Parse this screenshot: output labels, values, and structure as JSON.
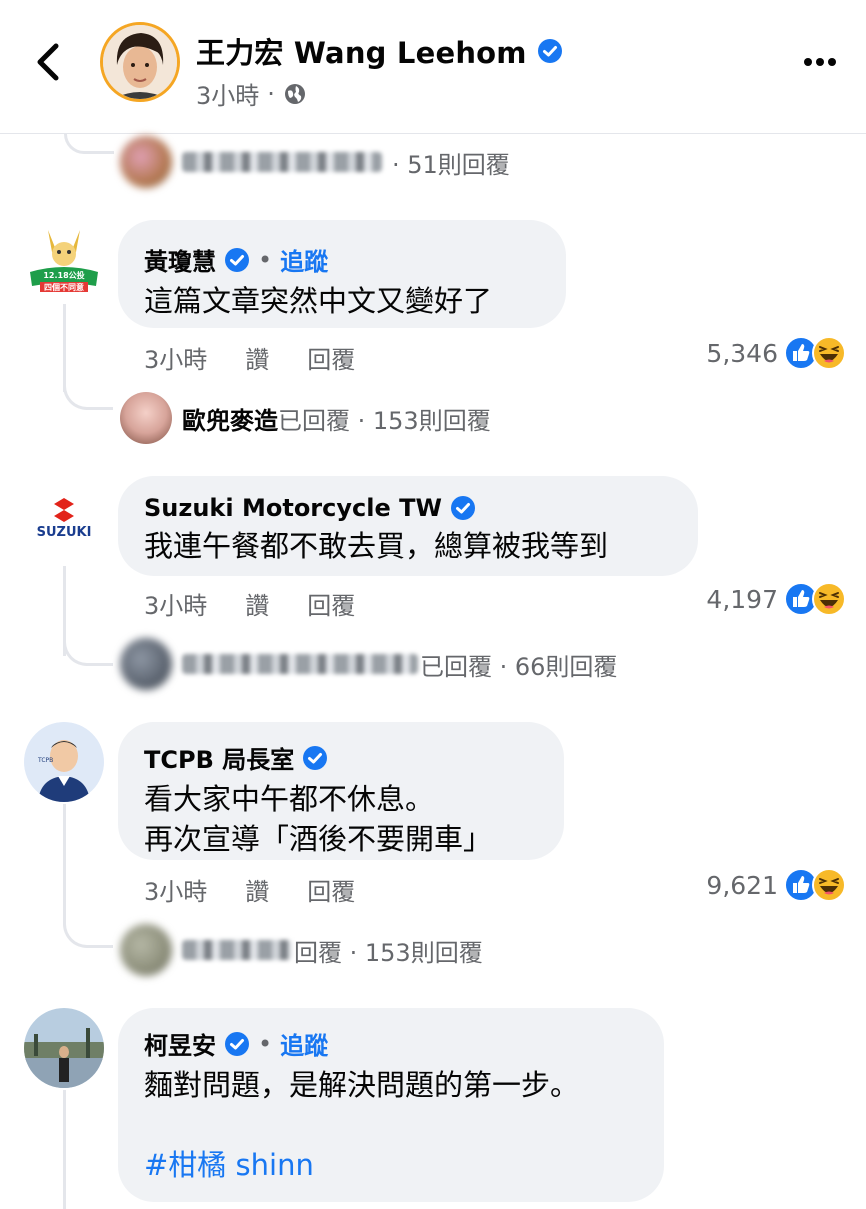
{
  "header": {
    "page_name": "王力宏 Wang Leehom",
    "time": "3小時",
    "separator": "·"
  },
  "replies": [
    {
      "suffix": "· 51則回覆"
    },
    {
      "name": "歐兜麥造",
      "suffix": "已回覆 · 153則回覆"
    },
    {
      "suffix": "已回覆 · 66則回覆"
    },
    {
      "suffix": "回覆 · 153則回覆"
    }
  ],
  "comments": [
    {
      "author": "黃瓊慧",
      "follow": "追蹤",
      "dot": "•",
      "lines": [
        "這篇文章突然中文又變好了"
      ],
      "time": "3小時",
      "like": "讚",
      "reply": "回覆",
      "reaction_count": "5,346"
    },
    {
      "author": "Suzuki Motorcycle TW",
      "lines": [
        "我連午餐都不敢去買，總算被我等到"
      ],
      "time": "3小時",
      "like": "讚",
      "reply": "回覆",
      "reaction_count": "4,197",
      "avatar_text": "SUZUKI"
    },
    {
      "author": "TCPB 局長室",
      "lines": [
        "看大家中午都不休息。",
        "再次宣導「酒後不要開車」"
      ],
      "time": "3小時",
      "like": "讚",
      "reply": "回覆",
      "reaction_count": "9,621"
    },
    {
      "author": "柯昱安",
      "follow": "追蹤",
      "dot": "•",
      "lines": [
        "麵對問題，是解決問題的第一步。"
      ],
      "hashtag": "#柑橘 shinn"
    }
  ],
  "avatar_badges": {
    "huang_line1": "12.18公投",
    "huang_line2": "四個不同意"
  },
  "colors": {
    "link_blue": "#1877f2",
    "bubble_gray": "#f0f2f5",
    "muted_text": "#65676b",
    "accent_orange": "#f5a623"
  },
  "icons": [
    "back-chevron-icon",
    "verified-badge-icon",
    "globe-icon",
    "more-dots-icon",
    "like-reaction-icon",
    "haha-reaction-icon"
  ]
}
